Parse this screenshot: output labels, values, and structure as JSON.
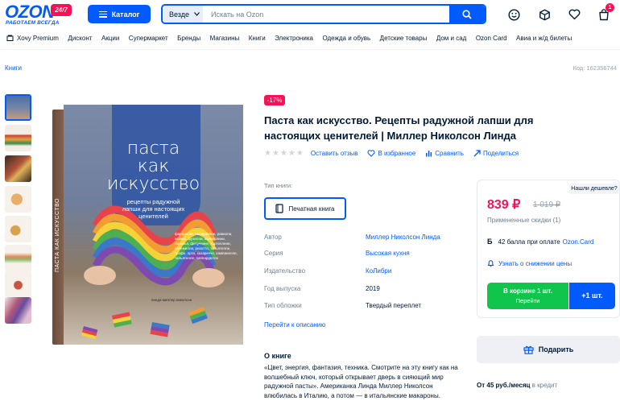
{
  "header": {
    "logo_word": "OZON",
    "logo_badge": "24/7",
    "logo_tagline": "РАБОТАЕМ ВСЕГДА",
    "catalog_label": "Каталог",
    "search_scope": "Везде",
    "search_placeholder": "Искать на Ozon",
    "cart_count": "1"
  },
  "nav": {
    "items": [
      "Хочу Premium",
      "Дисконт",
      "Акции",
      "Супермаркет",
      "Бренды",
      "Магазины",
      "Книги",
      "Электроника",
      "Одежда и обувь",
      "Детские товары",
      "Дом и сад",
      "Ozon Card",
      "Авиа и ж/д билеты"
    ]
  },
  "breadcrumb": "Книги",
  "product_code": "Код: 162356744",
  "product": {
    "discount": "-17%",
    "title": "Паста как искусство. Рецепты радужной лапши для настоящих ценителей | Миллер Николсон Линда",
    "actions": {
      "review": "Оставить отзыв",
      "favorite": "В избранное",
      "compare": "Сравнить",
      "share": "Поделиться"
    },
    "type_label": "Тип книги:",
    "type_value": "Печатная книга",
    "specs": [
      {
        "key": "Автор",
        "value": "Миллер Николсон Линда",
        "link": true
      },
      {
        "key": "Серия",
        "value": "Высокая кухня",
        "link": true
      },
      {
        "key": "Издательство",
        "value": "КоЛибри",
        "link": true
      },
      {
        "key": "Год выпуска",
        "value": "2019",
        "link": false
      },
      {
        "key": "Тип обложки",
        "value": "Твердый переплет",
        "link": false
      }
    ],
    "more_link": "Перейти к описанию",
    "about_title": "О книге",
    "about_text": "«Цвет, энергия, фантазия, техника. Смотрите на эту книгу как на волшебный ключ, который открывает дверь в сияющий мир радужной пасты». Американка Линда Миллер Николсон влюбилась в Италию, а потом — в итальянские макароны."
  },
  "book_cover": {
    "spine": "ПАСТА КАК ИСКУССТВО",
    "title_line1": "паста",
    "title_line2": "как",
    "title_line3": "искусство",
    "subtitle": "рецепты радужной лапши для настоящих ценителей",
    "small_text": "фарфалле, папарделле, равиоли, ньокки, фузилли, каппеллини, лазанья, фетуччине, тортеллини, пачемилли, ризотто, тальятелле, трофе, орзо, казаречче, кампанелле, тальятелле, паппарделле",
    "author": "линда миллер николсон"
  },
  "price_card": {
    "cheaper": "Нашли дешевле?",
    "price": "839 ₽",
    "old_price": "1 019 ₽",
    "applied": "Примененные скидки (1)",
    "bonus_letter": "Б",
    "bonus_text": "42 балла при оплате",
    "bonus_link": "Ozon.Card",
    "notify": "Узнать о снижении цены",
    "cart_line1": "В корзине 1 шт.",
    "cart_line2": "Перейти",
    "cart_plus": "+1 шт.",
    "gift": "Подарить",
    "credit_prefix": "От",
    "credit_amount": "45 руб./месяц",
    "credit_suffix": "в кредит"
  },
  "colors": {
    "brand": "#005bff",
    "accent": "#f91155",
    "cart_green": "#10c44c"
  }
}
